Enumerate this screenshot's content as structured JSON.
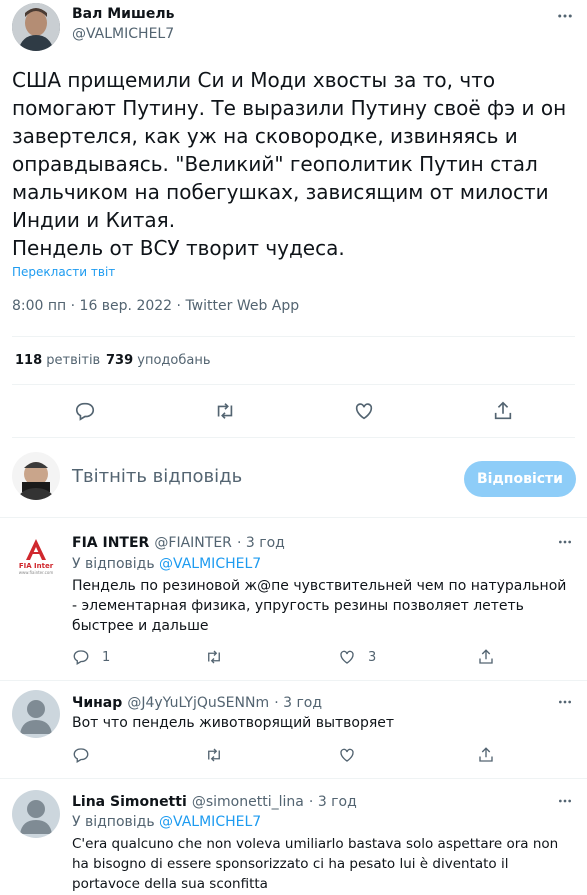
{
  "tweet": {
    "author_name": "Вал Мишель",
    "author_handle": "@VALMICHEL7",
    "text": "США прищемили Си и Моди хвосты за то, что помогают Путину. Те выразили Путину своё фэ и он завертелся, как уж на сковородке, извиняясь и оправдываясь. \"Великий\" геополитик Путин стал мальчиком на побегушках, зависящим от милости Индии и Китая.\nПендель от ВСУ творит чудеса.",
    "translate_link": "Перекласти твіт",
    "timestamp": "8:00 пп · 16 вер. 2022 · Twitter Web App",
    "retweets_count": "118",
    "retweets_label": "ретвітів",
    "likes_count": "739",
    "likes_label": "уподобань"
  },
  "composer": {
    "placeholder": "Твітніть відповідь",
    "reply_button": "Відповісти"
  },
  "replies": [
    {
      "name": "FIA INTER",
      "handle": "@FIAINTER",
      "time": "· 3 год",
      "reply_to_prefix": "У відповідь",
      "reply_to_handle": "@VALMICHEL7",
      "text": "Пендель по резиновой ж@пе чувствительней чем по натуральной - элементарная физика, упругость резины позволяет лететь быстрее и дальше",
      "reply_count": "1",
      "retweet_count": "",
      "like_count": "3",
      "avatar_text": "FIA Inter",
      "avatar_subtext": "www.fiainter.com"
    },
    {
      "name": "Чинар",
      "handle": "@J4yYuLYjQuSENNm",
      "time": "· 3 год",
      "text": "Вот что пендель животворящий вытворяет"
    },
    {
      "name": "Lina Simonetti",
      "handle": "@simonetti_lina",
      "time": "· 3 год",
      "reply_to_prefix": "У відповідь",
      "reply_to_handle": "@VALMICHEL7",
      "text": "C'era qualcuno che non voleva umiliarlo bastava solo aspettare ora non ha bisogno di essere sponsorizzato ci ha pesato lui è diventato il portavoce della sua sconfitta"
    }
  ],
  "colors": {
    "accent": "#1d9bf0",
    "muted": "#536471",
    "divider": "#eff3f4",
    "reply_button_bg": "#8ecdf8"
  },
  "icons": [
    "more-icon",
    "reply-icon",
    "retweet-icon",
    "like-icon",
    "share-icon",
    "default-avatar-icon"
  ]
}
